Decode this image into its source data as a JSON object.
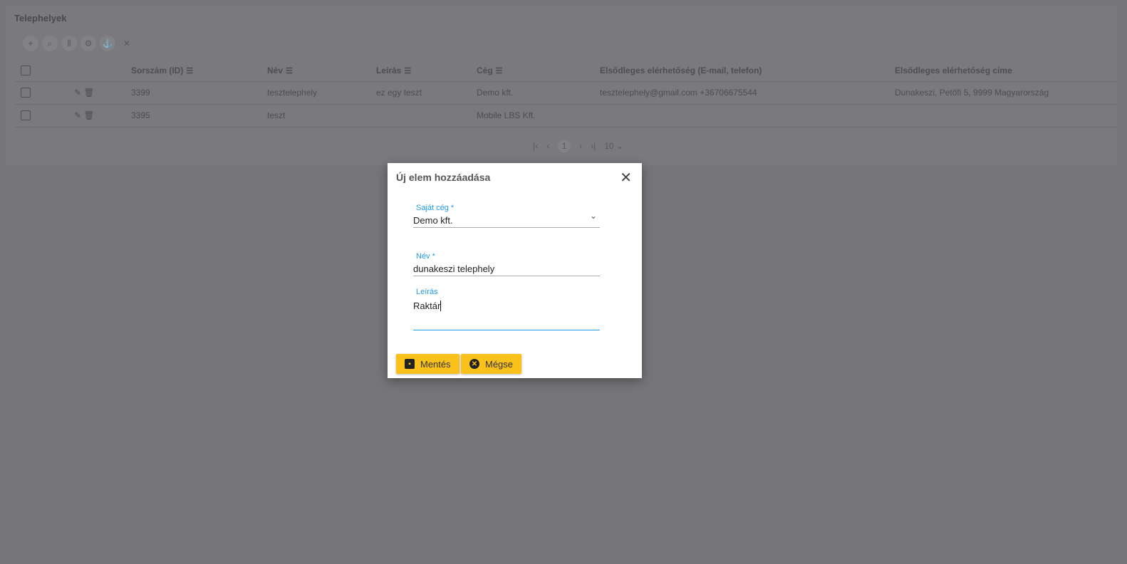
{
  "page": {
    "title": "Telephelyek"
  },
  "toolbar": [
    "add-icon",
    "search-icon",
    "columns-icon",
    "gear-icon",
    "export-icon",
    "close-icon"
  ],
  "table": {
    "headers": [
      "Sorszám (ID)",
      "Név",
      "Leírás",
      "Cég",
      "Elsődleges elérhetőség (E-mail, telefon)",
      "Elsődleges elérhetőség címe"
    ],
    "rows": [
      [
        "3399",
        "tesztelephely",
        "ez egy teszt",
        "Demo kft.",
        "tesztelephely@gmail.com +36706675544",
        "Dunakeszi, Petőfi 5, 9999 Magyarország"
      ],
      [
        "3395",
        "teszt",
        "",
        "Mobile LBS Kft.",
        "",
        ""
      ]
    ]
  },
  "pager": {
    "page": "1",
    "page_size": "10"
  },
  "dialog": {
    "title": "Új elem hozzáadása",
    "company_label": "Saját cég *",
    "company_value": "Demo kft.",
    "name_label": "Név *",
    "name_value": "dunakeszi telephely",
    "desc_label": "Leírás",
    "desc_value": "Raktár",
    "save": "Mentés",
    "cancel": "Mégse"
  }
}
